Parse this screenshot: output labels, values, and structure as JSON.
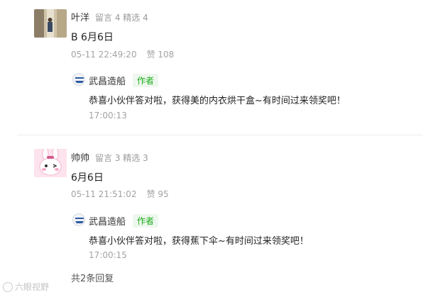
{
  "comments": [
    {
      "user_name": "叶洋",
      "meta": "留言 4 精选 4",
      "text": "B  6月6日",
      "datetime": "05-11 22:49:20",
      "likes": "赞 108",
      "reply": {
        "name": "武昌造船",
        "badge": "作者",
        "text": "恭喜小伙伴答对啦，获得美的内衣烘干盒~有时间过来领奖吧！",
        "time": "17:00:13"
      }
    },
    {
      "user_name": "帅帅",
      "meta": "留言 3 精选 3",
      "text": "6月6日",
      "datetime": "05-11 21:51:02",
      "likes": "赞 95",
      "reply": {
        "name": "武昌造船",
        "badge": "作者",
        "text": "恭喜小伙伴答对啦，获得蕉下伞~有时间过来领奖吧！",
        "time": "17:00:15"
      }
    }
  ],
  "footer": {
    "total_replies": "共2条回复"
  },
  "watermark": {
    "text": "六眼视野"
  },
  "colors": {
    "author_badge": "#1aad19",
    "meta_gray": "#a3a3a3"
  },
  "icons": {
    "user1_avatar": "photo-avatar",
    "user2_avatar": "cartoon-bunny-avatar",
    "reply_logo": "wuchang-shipbuilding-logo"
  }
}
